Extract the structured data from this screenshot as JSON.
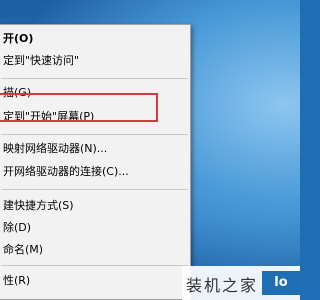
{
  "menu": {
    "items": [
      {
        "label": "开(O)",
        "bold": true
      },
      {
        "label": "定到\"快速访问\""
      },
      {
        "label": "描(G)"
      },
      {
        "label": "定到\"开始\"屏幕(P)"
      },
      {
        "label": "映射网络驱动器(N)..."
      },
      {
        "label": "开网络驱动器的连接(C)..."
      },
      {
        "label": "建快捷方式(S)"
      },
      {
        "label": "除(D)"
      },
      {
        "label": "命名(M)"
      },
      {
        "label": "性(R)"
      }
    ]
  },
  "watermark": {
    "text": "装机之家",
    "logo": "lo"
  },
  "colors": {
    "highlight": "#d23b3b",
    "menu_bg": "#f2f2f2"
  }
}
